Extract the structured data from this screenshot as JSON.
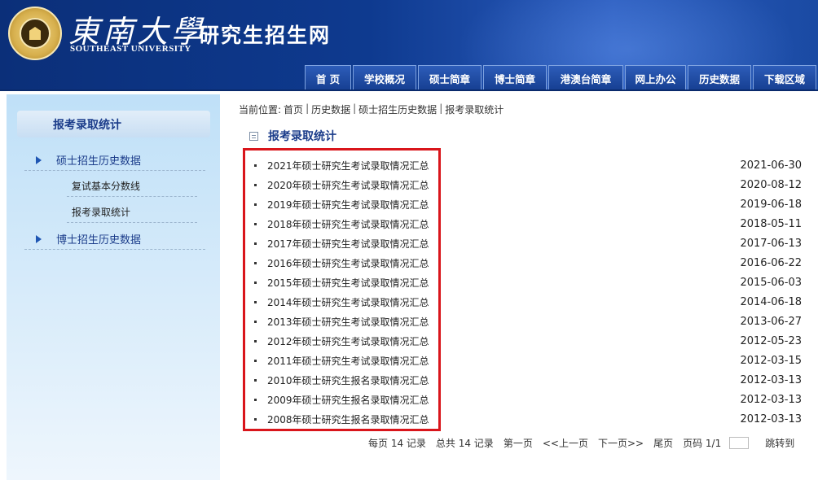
{
  "header": {
    "university_name": "東南大學",
    "university_en": "SOUTHEAST UNIVERSITY",
    "site_title": "研究生招生网"
  },
  "nav": {
    "items": [
      {
        "label": "首 页"
      },
      {
        "label": "学校概况"
      },
      {
        "label": "硕士简章"
      },
      {
        "label": "博士简章"
      },
      {
        "label": "港澳台简章"
      },
      {
        "label": "网上办公"
      },
      {
        "label": "历史数据"
      },
      {
        "label": "下载区域"
      }
    ]
  },
  "sidebar": {
    "title": "报考录取统计",
    "items": [
      {
        "label": "硕士招生历史数据",
        "icon": "arrow-right-icon"
      },
      {
        "label": "复试基本分数线"
      },
      {
        "label": "报考录取统计"
      },
      {
        "label": "博士招生历史数据",
        "icon": "arrow-right-icon"
      }
    ]
  },
  "breadcrumb": {
    "prefix": "当前位置:",
    "items": [
      "首页",
      "历史数据",
      "硕士招生历史数据",
      "报考录取统计"
    ]
  },
  "section": {
    "title": "报考录取统计",
    "icon": "document-icon"
  },
  "articles": [
    {
      "title": "2021年硕士研究生考试录取情况汇总",
      "date": "2021-06-30"
    },
    {
      "title": "2020年硕士研究生考试录取情况汇总",
      "date": "2020-08-12"
    },
    {
      "title": "2019年硕士研究生考试录取情况汇总",
      "date": "2019-06-18"
    },
    {
      "title": "2018年硕士研究生考试录取情况汇总",
      "date": "2018-05-11"
    },
    {
      "title": "2017年硕士研究生考试录取情况汇总",
      "date": "2017-06-13"
    },
    {
      "title": "2016年硕士研究生考试录取情况汇总",
      "date": "2016-06-22"
    },
    {
      "title": "2015年硕士研究生考试录取情况汇总",
      "date": "2015-06-03"
    },
    {
      "title": "2014年硕士研究生考试录取情况汇总",
      "date": "2014-06-18"
    },
    {
      "title": "2013年硕士研究生考试录取情况汇总",
      "date": "2013-06-27"
    },
    {
      "title": "2012年硕士研究生考试录取情况汇总",
      "date": "2012-05-23"
    },
    {
      "title": "2011年硕士研究生考试录取情况汇总",
      "date": "2012-03-15"
    },
    {
      "title": "2010年硕士研究生报名录取情况汇总",
      "date": "2012-03-13"
    },
    {
      "title": "2009年硕士研究生报名录取情况汇总",
      "date": "2012-03-13"
    },
    {
      "title": "2008年硕士研究生报名录取情况汇总",
      "date": "2012-03-13"
    }
  ],
  "pager": {
    "per_page": "每页 14 记录",
    "total": "总共 14 记录",
    "first": "第一页",
    "prev": "<<上一页",
    "next": "下一页>>",
    "last": "尾页",
    "page": "页码 1/1",
    "jump": "跳转到"
  },
  "colors": {
    "header_blue": "#0e3a8f",
    "highlight_red": "#d9151b",
    "title_blue": "#1b3c8a"
  }
}
